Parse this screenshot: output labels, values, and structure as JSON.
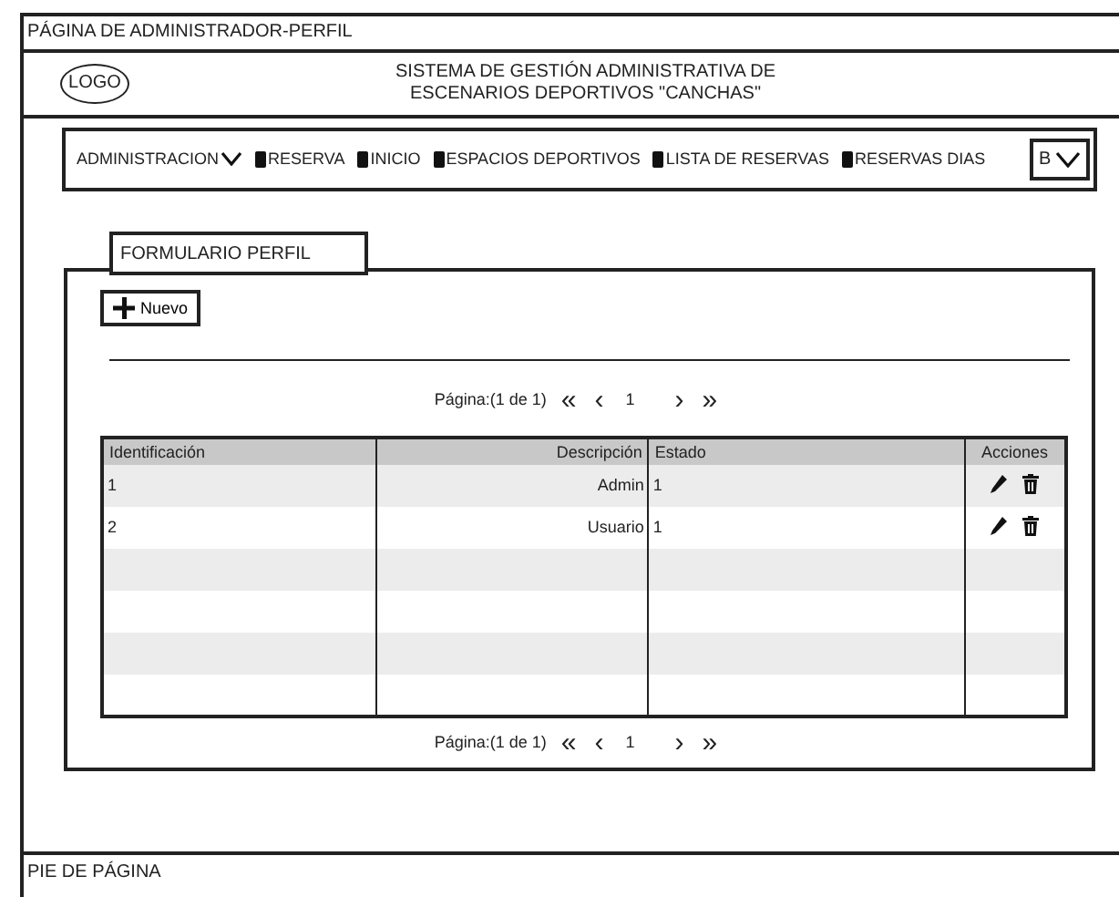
{
  "window": {
    "title": "PÁGINA DE ADMINISTRADOR-PERFIL"
  },
  "header": {
    "logo": "LOGO",
    "title_lines": [
      "SISTEMA DE GESTIÓN ADMINISTRATIVA DE",
      "ESCENARIOS DEPORTIVOS \"CANCHAS\""
    ]
  },
  "nav": {
    "items": [
      {
        "label": "ADMINISTRACION",
        "kind": "dropdown"
      },
      {
        "label": "RESERVA",
        "kind": "link"
      },
      {
        "label": "INICIO",
        "kind": "link"
      },
      {
        "label": "ESPACIOS DEPORTIVOS",
        "kind": "link"
      },
      {
        "label": "LISTA DE RESERVAS",
        "kind": "link"
      },
      {
        "label": "RESERVAS DIAS",
        "kind": "link"
      }
    ],
    "select": {
      "value": "B"
    }
  },
  "tab": {
    "label": "FORMULARIO PERFIL"
  },
  "new_button": {
    "label": "Nuevo"
  },
  "pagination_top": {
    "label": "Página:(1 de 1)",
    "first": "«",
    "prev": "‹",
    "page": "1",
    "next": "›",
    "last": "»"
  },
  "table": {
    "columns": [
      "Identificación",
      "Descripción",
      "Estado",
      "Acciones"
    ],
    "rows": [
      {
        "id": "1",
        "description": "Admin",
        "status": "1"
      },
      {
        "id": "2",
        "description": "Usuario",
        "status": "1"
      }
    ]
  },
  "pagination_bottom": {
    "label": "Página:(1 de 1)",
    "first": "«",
    "prev": "‹",
    "page": "1",
    "next": "›",
    "last": "»"
  },
  "footer": {
    "text": "PIE DE PÁGINA"
  }
}
